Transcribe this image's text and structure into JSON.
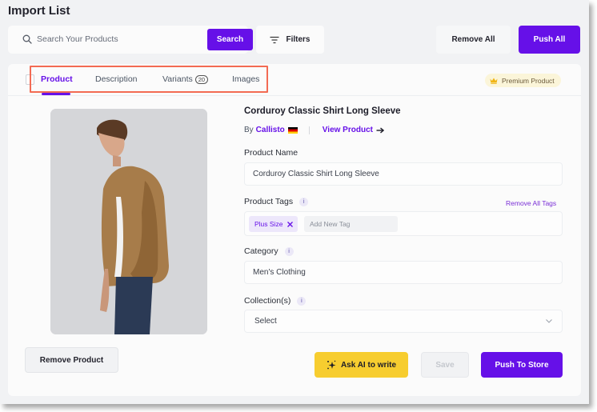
{
  "header": {
    "title": "Import List",
    "search": {
      "placeholder": "Search Your Products",
      "value": "",
      "button_label": "Search",
      "icon": "search-icon"
    },
    "filters_label": "Filters",
    "remove_all_label": "Remove All",
    "push_all_label": "Push All"
  },
  "tabs": [
    {
      "label": "Product",
      "active": true
    },
    {
      "label": "Description",
      "active": false
    },
    {
      "label": "Variants",
      "count": "20",
      "active": false
    },
    {
      "label": "Images",
      "active": false
    }
  ],
  "premium_badge": {
    "label": "Premium Product",
    "icon": "crown-icon"
  },
  "product": {
    "title": "Corduroy Classic Shirt Long Sleeve",
    "by_prefix": "By",
    "vendor": "Callisto",
    "vendor_flag": "germany-flag-icon",
    "view_product_label": "View Product",
    "image_alt": "Man wearing tan corduroy long sleeve shirt"
  },
  "form": {
    "product_name_label": "Product Name",
    "product_name_value": "Corduroy Classic Shirt Long Sleeve",
    "product_tags_label": "Product Tags",
    "remove_all_tags_label": "Remove All Tags",
    "tags": [
      "Plus Size"
    ],
    "tag_input_placeholder": "Add New Tag",
    "category_label": "Category",
    "category_value": "Men's Clothing",
    "collections_label": "Collection(s)",
    "collections_value": "Select"
  },
  "actions": {
    "remove_product_label": "Remove Product",
    "ask_ai_label": "Ask AI to write",
    "save_label": "Save",
    "push_to_store_label": "Push To Store"
  },
  "colors": {
    "primary": "#6610e8",
    "ai_button": "#f7cd2f",
    "highlight": "#f36b53"
  }
}
